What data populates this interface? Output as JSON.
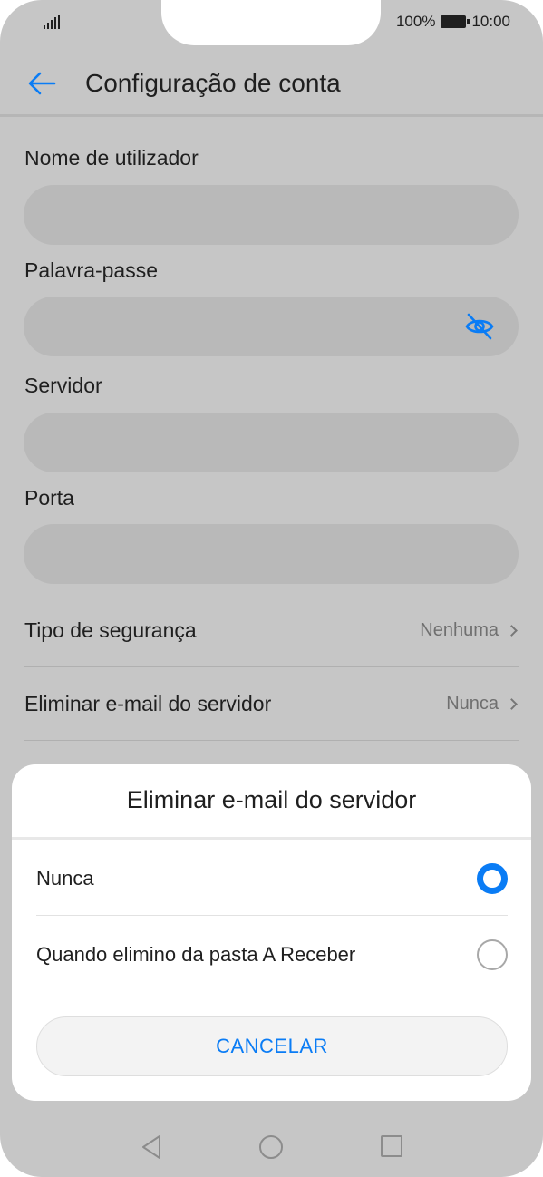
{
  "status_bar": {
    "battery_percent": "100%",
    "time": "10:00",
    "signal_icon": "signal-icon",
    "battery_icon": "battery-icon"
  },
  "app_bar": {
    "back_icon": "arrow-left-icon",
    "title": "Configuração de conta",
    "accent_color": "#0a7cf5"
  },
  "form": {
    "username_label": "Nome de utilizador",
    "username_value": "",
    "password_label": "Palavra-passe",
    "password_value": "",
    "password_toggle_icon": "eye-off-icon",
    "server_label": "Servidor",
    "server_value": "",
    "port_label": "Porta",
    "port_value": ""
  },
  "settings": [
    {
      "label": "Tipo de segurança",
      "value": "Nenhuma"
    },
    {
      "label": "Eliminar e-mail do servidor",
      "value": "Nunca"
    }
  ],
  "dialog": {
    "title": "Eliminar e-mail do servidor",
    "options": [
      {
        "label": "Nunca",
        "selected": true
      },
      {
        "label": "Quando elimino da pasta A Receber",
        "selected": false
      }
    ],
    "cancel_label": "CANCELAR"
  },
  "nav_bar": {
    "back_icon": "triangle-back-icon",
    "home_icon": "circle-home-icon",
    "recents_icon": "square-recents-icon"
  }
}
